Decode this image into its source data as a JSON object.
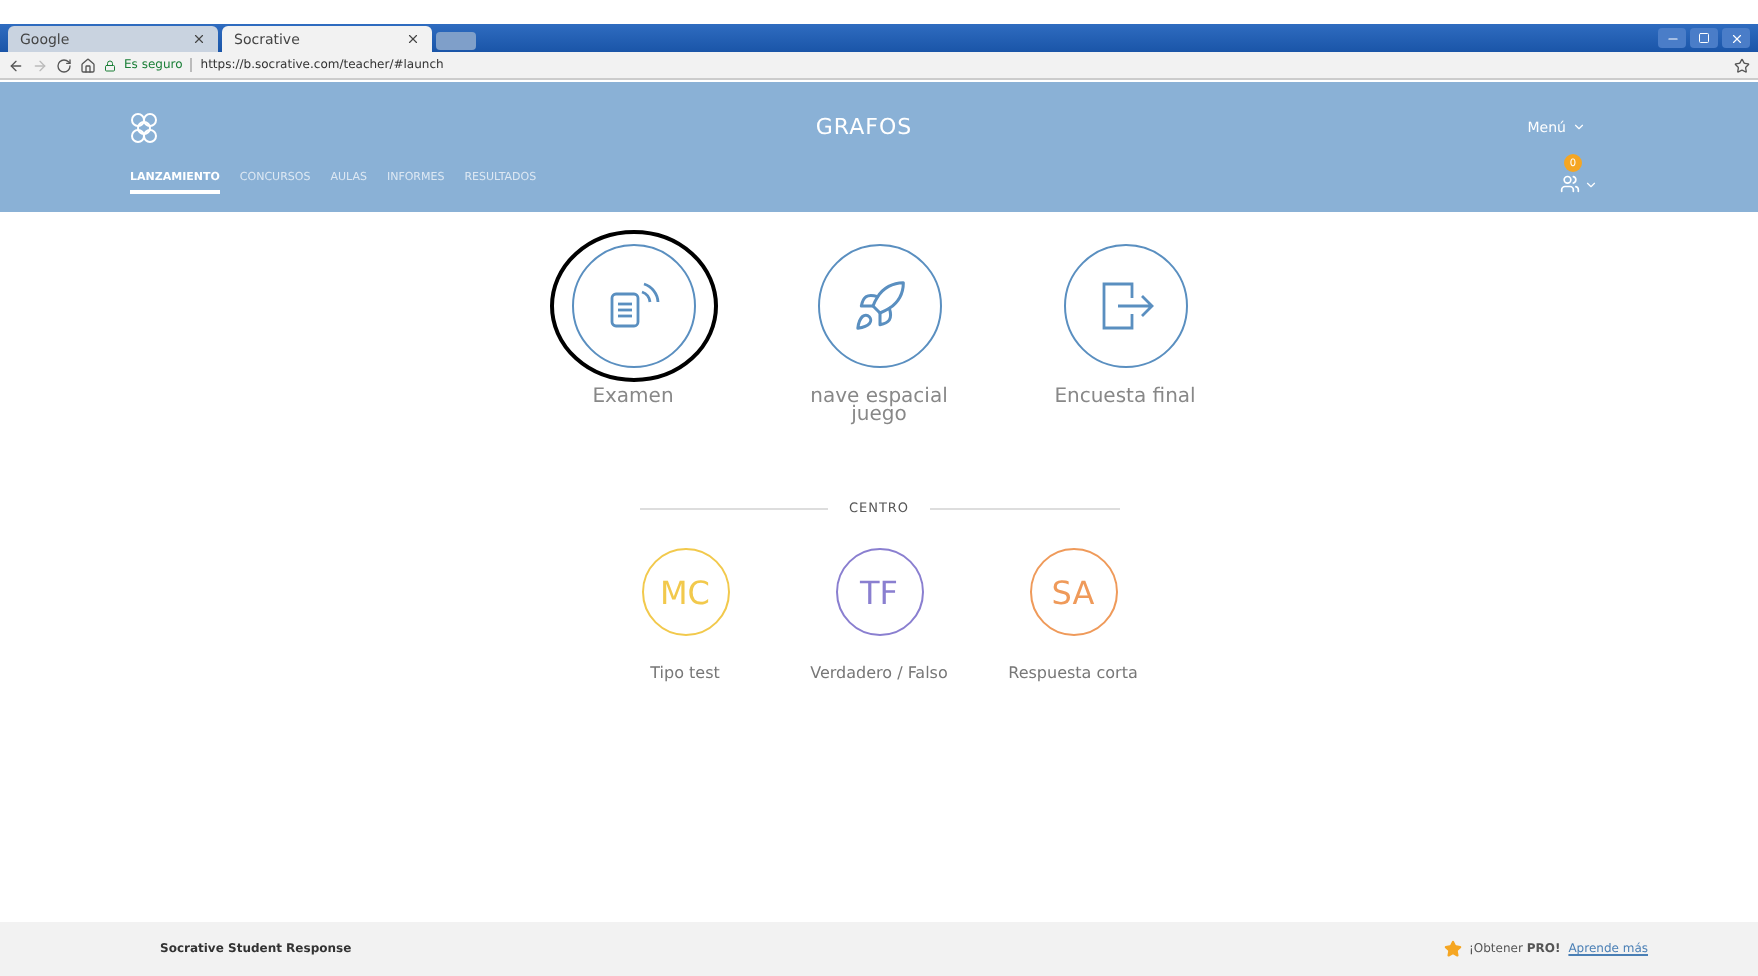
{
  "browser": {
    "tabs": [
      {
        "label": "Google",
        "selected": false
      },
      {
        "label": "Socrative",
        "selected": true
      }
    ],
    "secure_label": "Es seguro",
    "url": "https://b.socrative.com/teacher/#launch"
  },
  "header": {
    "title": "GRAFOS",
    "menu": "Menú",
    "notification_count": "0"
  },
  "nav": [
    {
      "label": "LANZAMIENTO",
      "selected": true
    },
    {
      "label": "CONCURSOS",
      "selected": false
    },
    {
      "label": "AULAS",
      "selected": false
    },
    {
      "label": "INFORMES",
      "selected": false
    },
    {
      "label": "RESULTADOS",
      "selected": false
    }
  ],
  "activities": [
    {
      "kind": "quiz",
      "label": "Examen",
      "highlighted": true
    },
    {
      "kind": "rocket",
      "label": "nave espacial juego",
      "highlighted": false
    },
    {
      "kind": "exit",
      "label": "Encuesta final",
      "highlighted": false
    }
  ],
  "section_title": "CENTRO",
  "questions": [
    {
      "code": "MC",
      "label": "Tipo test",
      "color": "#f2c94c"
    },
    {
      "code": "TF",
      "label": "Verdadero / Falso",
      "color": "#8a7fd0"
    },
    {
      "code": "SA",
      "label": "Respuesta corta",
      "color": "#ef9a5a"
    }
  ],
  "footer": {
    "brand": "Socrative Student Response",
    "promo": "¡Obtener **PRO!**",
    "link": "Aprende más"
  }
}
